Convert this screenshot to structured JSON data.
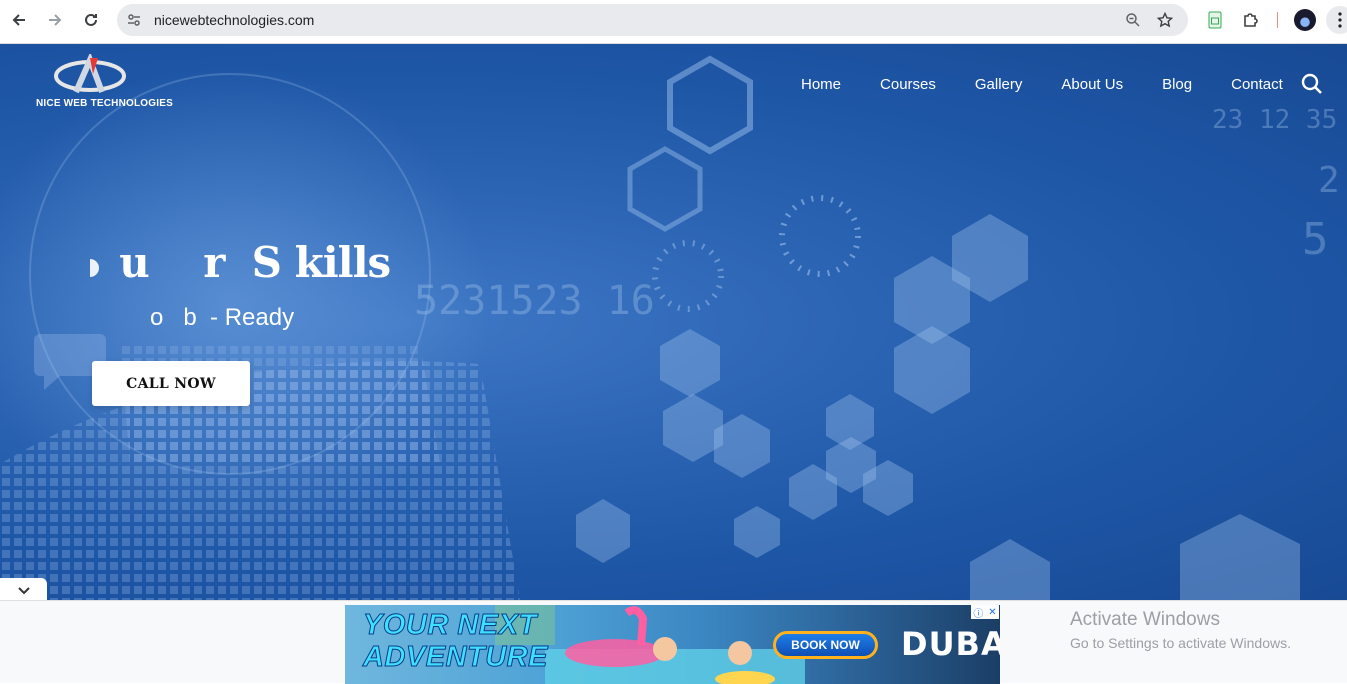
{
  "browser": {
    "url": "nicewebtechnologies.com",
    "icons": {
      "back": "arrow-left-icon",
      "forward": "arrow-right-icon",
      "reload": "reload-icon",
      "site_info": "tune-icon",
      "zoom": "zoom-icon",
      "bookmark": "star-icon",
      "extension1": "sheets-extension-icon",
      "extensions": "puzzle-icon",
      "menu": "kebab-menu-icon"
    }
  },
  "site": {
    "brand_name": "NICE WEB TECHNOLOGIES",
    "nav": [
      "Home",
      "Courses",
      "Gallery",
      "About Us",
      "Blog",
      "Contact"
    ],
    "hero": {
      "headline": "  u    r  S kills",
      "subline": "o   b  - Ready",
      "cta": "CALL NOW"
    },
    "accent_color": "#2b64b3"
  },
  "ad": {
    "headline_line1": "YOUR NEXT",
    "headline_line2": "ADVENTURE",
    "button": "BOOK NOW",
    "brand": "DUBAI"
  },
  "windows_notice": {
    "title": "Activate Windows",
    "subtitle": "Go to Settings to activate Windows."
  }
}
